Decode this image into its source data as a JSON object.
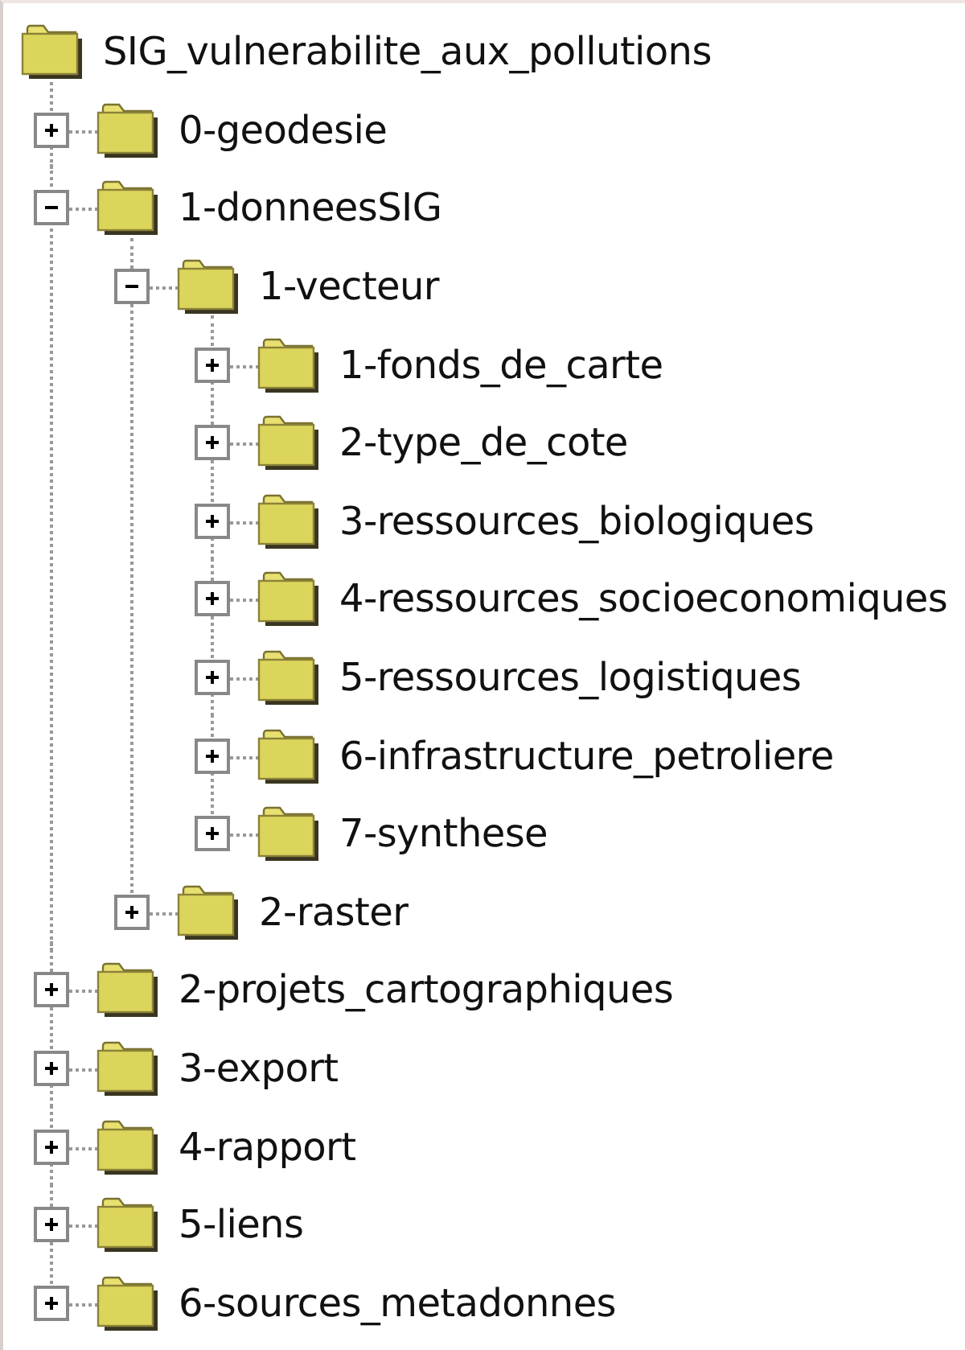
{
  "root": {
    "label": "SIG_vulnerabilite_aux_pollutions",
    "children": [
      {
        "label": "0-geodesie",
        "expanded": false
      },
      {
        "label": "1-donneesSIG",
        "expanded": true,
        "children": [
          {
            "label": "1-vecteur",
            "expanded": true,
            "children": [
              {
                "label": "1-fonds_de_carte",
                "expanded": false
              },
              {
                "label": "2-type_de_cote",
                "expanded": false
              },
              {
                "label": "3-ressources_biologiques",
                "expanded": false
              },
              {
                "label": "4-ressources_socioeconomiques",
                "expanded": false
              },
              {
                "label": "5-ressources_logistiques",
                "expanded": false
              },
              {
                "label": "6-infrastructure_petroliere",
                "expanded": false
              },
              {
                "label": "7-synthese",
                "expanded": false
              }
            ]
          },
          {
            "label": "2-raster",
            "expanded": false
          }
        ]
      },
      {
        "label": "2-projets_cartographiques",
        "expanded": false
      },
      {
        "label": "3-export",
        "expanded": false
      },
      {
        "label": "4-rapport",
        "expanded": false
      },
      {
        "label": "5-liens",
        "expanded": false
      },
      {
        "label": "6-sources_metadonnes",
        "expanded": false
      }
    ]
  }
}
